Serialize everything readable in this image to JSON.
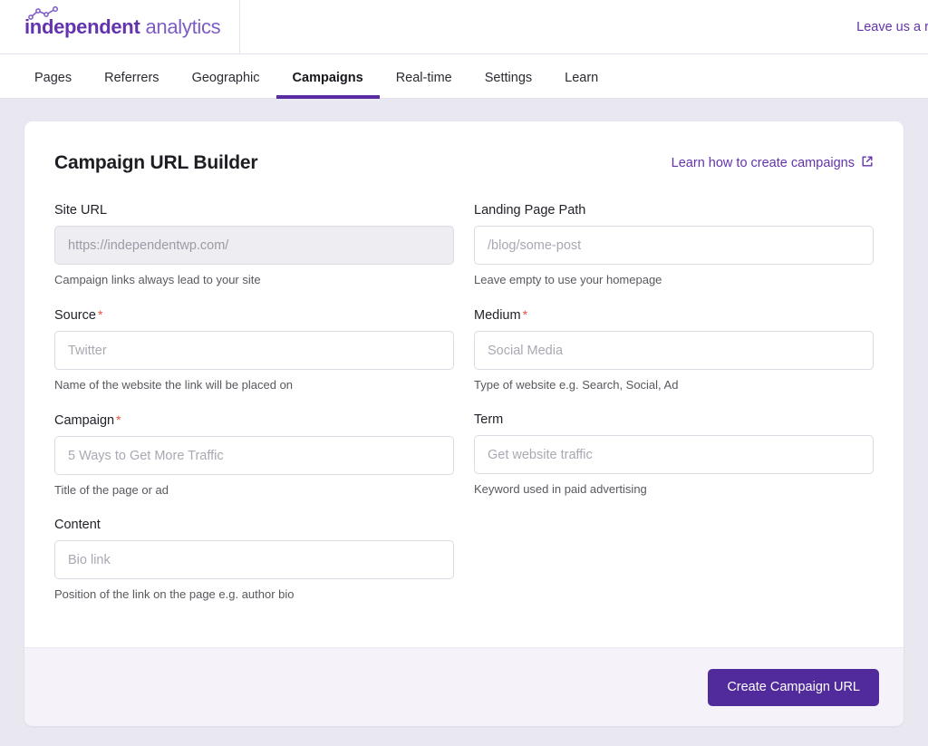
{
  "header": {
    "logo": {
      "bold_text": "independent",
      "light_text": "analytics",
      "icon": "line-chart-spark-icon"
    },
    "leave_review_label": "Leave us a review"
  },
  "nav": {
    "items": [
      {
        "label": "Pages",
        "active": false
      },
      {
        "label": "Referrers",
        "active": false
      },
      {
        "label": "Geographic",
        "active": false
      },
      {
        "label": "Campaigns",
        "active": true
      },
      {
        "label": "Real-time",
        "active": false
      },
      {
        "label": "Settings",
        "active": false
      },
      {
        "label": "Learn",
        "active": false
      }
    ]
  },
  "card": {
    "title": "Campaign URL Builder",
    "help_link_label": "Learn how to create campaigns",
    "help_link_icon": "external-link-icon",
    "fields": [
      {
        "label": "Site URL",
        "required": false,
        "value": "",
        "placeholder": "https://independentwp.com/",
        "hint": "Campaign links always lead to your site",
        "disabled": true
      },
      {
        "label": "Landing Page Path",
        "required": false,
        "value": "",
        "placeholder": "/blog/some-post",
        "hint": "Leave empty to use your homepage",
        "disabled": false
      },
      {
        "label": "Source",
        "required": true,
        "value": "",
        "placeholder": "Twitter",
        "hint": "Name of the website the link will be placed on",
        "disabled": false
      },
      {
        "label": "Medium",
        "required": true,
        "value": "",
        "placeholder": "Social Media",
        "hint": "Type of website e.g. Search, Social, Ad",
        "disabled": false
      },
      {
        "label": "Campaign",
        "required": true,
        "value": "",
        "placeholder": "5 Ways to Get More Traffic",
        "hint": "Title of the page or ad",
        "disabled": false
      },
      {
        "label": "Term",
        "required": false,
        "value": "",
        "placeholder": "Get website traffic",
        "hint": "Keyword used in paid advertising",
        "disabled": false
      },
      {
        "label": "Content",
        "required": false,
        "value": "",
        "placeholder": "Bio link",
        "hint": "Position of the link on the page e.g. author bio",
        "disabled": false
      }
    ],
    "required_marker": "*",
    "submit_label": "Create Campaign URL"
  },
  "colors": {
    "brand_purple": "#6233ad",
    "button_purple": "#512a9b",
    "active_tab_underline": "#5a2ca3",
    "required_red": "#e8543b",
    "page_background": "#e9e8f1",
    "footer_background": "#f5f3f9"
  }
}
